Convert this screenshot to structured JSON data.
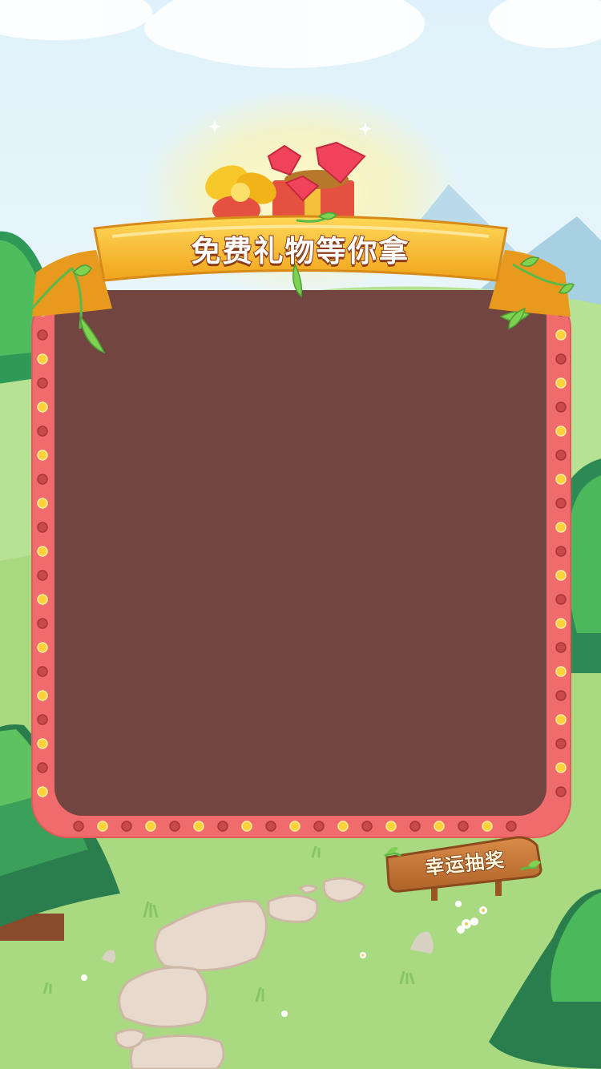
{
  "banner": {
    "title": "免费礼物等你拿"
  },
  "lottery_sign": {
    "label": "幸运抽奖"
  },
  "colors": {
    "sky": "#dff1fa",
    "grass": "#a7d97d",
    "frame": "#f06b6b",
    "panel": "#734540",
    "ribbon": "#f6b92c",
    "sign_wood": "#c97a3a"
  }
}
